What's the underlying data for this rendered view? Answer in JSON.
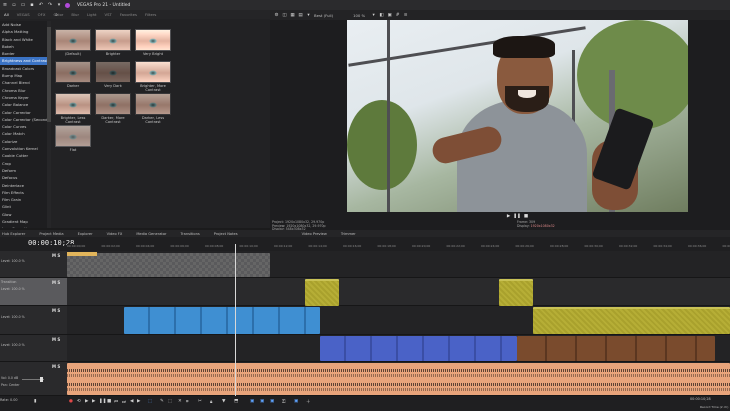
{
  "window": {
    "title": "VEGAS Pro 21 - Untitled",
    "app_logo": "vegas-logo"
  },
  "fx_browser": {
    "tabs": [
      "All",
      "VEGAS",
      "OFX",
      "Color",
      "Blur",
      "Light",
      "VST",
      "Favorites",
      "Filters"
    ],
    "items": [
      "Add Noise",
      "Alpha Matting",
      "Black and White",
      "Bokeh",
      "Border",
      "Brightness and Contrast",
      "Broadcast Colors",
      "Bump Map",
      "Channel Blend",
      "Chroma Blur",
      "Chroma Keyer",
      "Color Balance",
      "Color Corrector",
      "Color Corrector (Secondary)",
      "Color Curves",
      "Color Match",
      "Colorize",
      "Convolution Kernel",
      "Cookie Cutter",
      "Crop",
      "Deform",
      "Defocus",
      "Deinterlace",
      "Film Effects",
      "Film Grain",
      "Glint",
      "Glow",
      "Gradient Map",
      "Lens Correction",
      "Lens Flare",
      "Levels"
    ],
    "selected_index": 5,
    "presets": [
      {
        "label": "(Default)"
      },
      {
        "label": "Brighter"
      },
      {
        "label": "Very Bright"
      },
      {
        "label": "Darker"
      },
      {
        "label": "Very Dark"
      },
      {
        "label": "Brighter, More Contrast"
      },
      {
        "label": "Brighter, Less Contrast"
      },
      {
        "label": "Darker, More Contrast"
      },
      {
        "label": "Darker, Less Contrast"
      },
      {
        "label": "Flat"
      }
    ]
  },
  "preview": {
    "quality": "Best (Full)",
    "zoom": "100 %",
    "project": "Project: 1920x1080x32, 29.970p",
    "preview_res": "Preview: 1920x1080x32, 29.970p",
    "display": "Display: 548x308x32",
    "frame_label": "Frame:",
    "frame_value": "309",
    "selected_label": "Display:",
    "selected_value": "1920x1080x32"
  },
  "bottom_tabs": [
    "Project Media",
    "Explorer",
    "Video FX",
    "Media Generator",
    "Transitions",
    "Project Notes"
  ],
  "bottom_tabs_prefix": [
    "Video Preview",
    "Trimmer",
    "Hub Explorer"
  ],
  "timeline": {
    "timecode": "00:00:10;28",
    "ruler": [
      "00:00:00;00",
      "00:00:02;00",
      "00:00:04;00",
      "00:00:06;00",
      "00:00:08;00",
      "00:00:10;00",
      "00:00:12;00",
      "00:00:14;00",
      "00:00:16;00",
      "00:00:18;00",
      "00:00:20;00",
      "00:00:22;00",
      "00:00:24;00",
      "00:00:26;00",
      "00:00:28;00",
      "00:00:30;00",
      "00:00:32;00",
      "00:00:34;00",
      "00:00:36;00",
      "00:00:38;00"
    ],
    "tracks": [
      {
        "name": "Level: 100.0 %",
        "ms": "M S"
      },
      {
        "name": "Transition",
        "level": "Level: 100.0 %",
        "ms": "M S"
      },
      {
        "name": "Level: 100.0 %",
        "ms": "M S"
      },
      {
        "name": "Level: 100.0 %",
        "ms": "M S"
      },
      {
        "name": "Vol: 0.0 dB",
        "pan": "Pan: Center",
        "ms": "M S"
      }
    ],
    "playhead_time": "00:00:10;28"
  },
  "status": {
    "rate": "Rate: 0.00",
    "right_time": "00:00:10;28",
    "record": "Record Time (2 ch)"
  }
}
